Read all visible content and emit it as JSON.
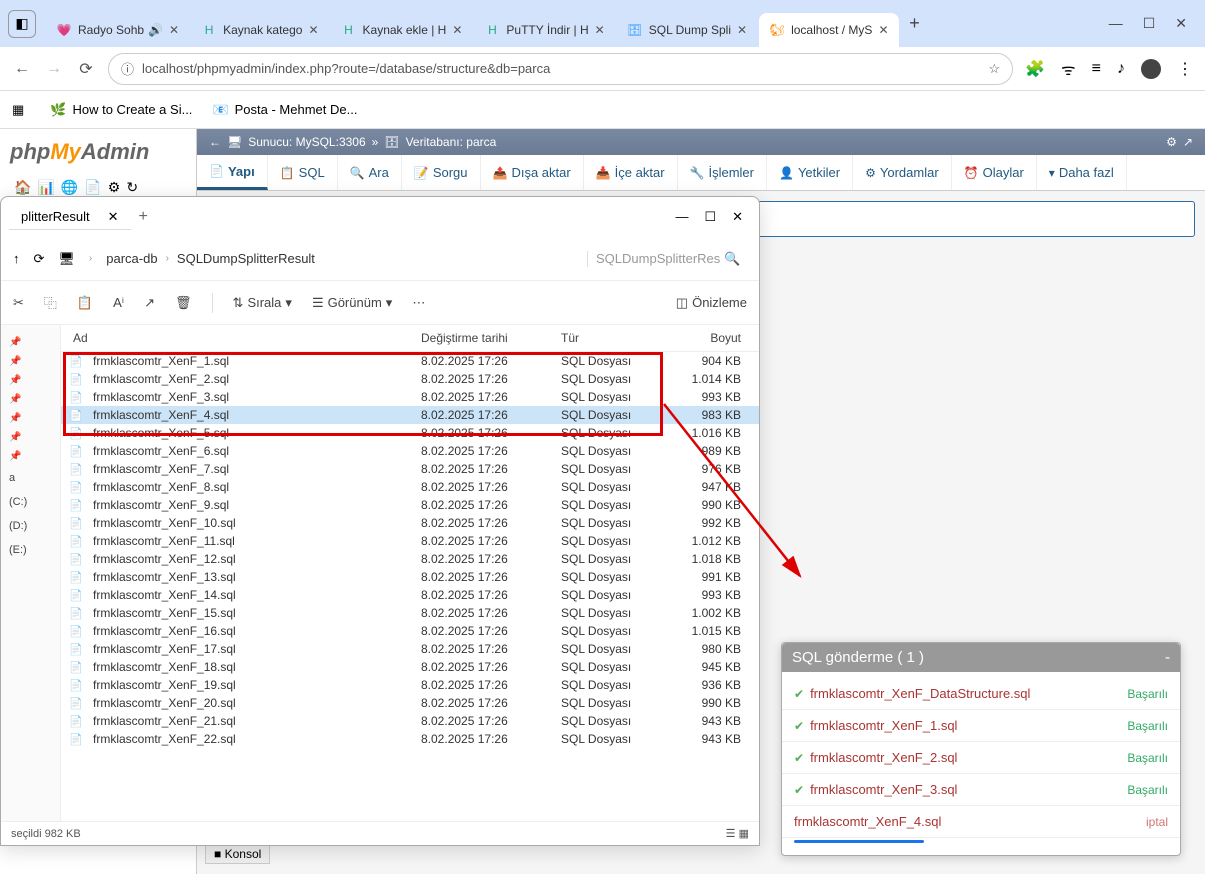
{
  "browser": {
    "tabs": [
      {
        "fav": "💗",
        "title": "Radyo Sohb",
        "extras": "🔊"
      },
      {
        "fav": "H",
        "favcolor": "#2a8",
        "title": "Kaynak katego"
      },
      {
        "fav": "H",
        "favcolor": "#2a8",
        "title": "Kaynak ekle | H"
      },
      {
        "fav": "H",
        "favcolor": "#2a8",
        "title": "PuTTY İndir | H"
      },
      {
        "fav": "🗄",
        "favcolor": "#29f",
        "title": "SQL Dump Spli"
      },
      {
        "fav": "🐿",
        "favcolor": "#f80",
        "title": "localhost / MyS",
        "active": true
      }
    ],
    "url": "localhost/phpmyadmin/index.php?route=/database/structure&db=parca",
    "bookmarks": [
      {
        "icon": "▦",
        "text": ""
      },
      {
        "icon": "🌿",
        "text": "How to Create a Si..."
      },
      {
        "icon": "📧",
        "text": "Posta - Mehmet De..."
      }
    ]
  },
  "pma": {
    "logo": {
      "p1": "php",
      "p2": "My",
      "p3": "Admin"
    },
    "breadcrumb": {
      "server": "Sunucu: MySQL:3306",
      "db": "Veritabanı: parca"
    },
    "tabs": [
      {
        "icon": "📄",
        "label": "Yapı",
        "active": true
      },
      {
        "icon": "📋",
        "label": "SQL"
      },
      {
        "icon": "🔍",
        "label": "Ara"
      },
      {
        "icon": "📝",
        "label": "Sorgu"
      },
      {
        "icon": "📤",
        "label": "Dışa aktar"
      },
      {
        "icon": "📥",
        "label": "İçe aktar"
      },
      {
        "icon": "🔧",
        "label": "İşlemler"
      },
      {
        "icon": "👤",
        "label": "Yetkiler"
      },
      {
        "icon": "⚙",
        "label": "Yordamlar"
      },
      {
        "icon": "⏰",
        "label": "Olaylar"
      },
      {
        "icon": "▾",
        "label": "Daha fazl"
      }
    ]
  },
  "explorer": {
    "tab_title": "plitterResult",
    "path": [
      "parca-db",
      "SQLDumpSplitterResult"
    ],
    "search_placeholder": "SQLDumpSplitterRes",
    "tools": {
      "sort": "Sırala",
      "view": "Görünüm",
      "preview": "Önizleme"
    },
    "headers": {
      "name": "Ad",
      "date": "Değiştirme tarihi",
      "type": "Tür",
      "size": "Boyut"
    },
    "sidebar_items": [
      "a",
      "(C:)",
      "(D:)",
      "(E:)"
    ],
    "rows": [
      {
        "name": "frmklascomtr_XenF_1.sql",
        "date": "8.02.2025 17:26",
        "type": "SQL Dosyası",
        "size": "904 KB",
        "hl": true
      },
      {
        "name": "frmklascomtr_XenF_2.sql",
        "date": "8.02.2025 17:26",
        "type": "SQL Dosyası",
        "size": "1.014 KB",
        "hl": true
      },
      {
        "name": "frmklascomtr_XenF_3.sql",
        "date": "8.02.2025 17:26",
        "type": "SQL Dosyası",
        "size": "993 KB",
        "hl": true
      },
      {
        "name": "frmklascomtr_XenF_4.sql",
        "date": "8.02.2025 17:26",
        "type": "SQL Dosyası",
        "size": "983 KB",
        "hl": true,
        "sel": true
      },
      {
        "name": "frmklascomtr_XenF_5.sql",
        "date": "8.02.2025 17:26",
        "type": "SQL Dosyası",
        "size": "1.016 KB"
      },
      {
        "name": "frmklascomtr_XenF_6.sql",
        "date": "8.02.2025 17:26",
        "type": "SQL Dosyası",
        "size": "989 KB"
      },
      {
        "name": "frmklascomtr_XenF_7.sql",
        "date": "8.02.2025 17:26",
        "type": "SQL Dosyası",
        "size": "976 KB"
      },
      {
        "name": "frmklascomtr_XenF_8.sql",
        "date": "8.02.2025 17:26",
        "type": "SQL Dosyası",
        "size": "947 KB"
      },
      {
        "name": "frmklascomtr_XenF_9.sql",
        "date": "8.02.2025 17:26",
        "type": "SQL Dosyası",
        "size": "990 KB"
      },
      {
        "name": "frmklascomtr_XenF_10.sql",
        "date": "8.02.2025 17:26",
        "type": "SQL Dosyası",
        "size": "992 KB"
      },
      {
        "name": "frmklascomtr_XenF_11.sql",
        "date": "8.02.2025 17:26",
        "type": "SQL Dosyası",
        "size": "1.012 KB"
      },
      {
        "name": "frmklascomtr_XenF_12.sql",
        "date": "8.02.2025 17:26",
        "type": "SQL Dosyası",
        "size": "1.018 KB"
      },
      {
        "name": "frmklascomtr_XenF_13.sql",
        "date": "8.02.2025 17:26",
        "type": "SQL Dosyası",
        "size": "991 KB"
      },
      {
        "name": "frmklascomtr_XenF_14.sql",
        "date": "8.02.2025 17:26",
        "type": "SQL Dosyası",
        "size": "993 KB"
      },
      {
        "name": "frmklascomtr_XenF_15.sql",
        "date": "8.02.2025 17:26",
        "type": "SQL Dosyası",
        "size": "1.002 KB"
      },
      {
        "name": "frmklascomtr_XenF_16.sql",
        "date": "8.02.2025 17:26",
        "type": "SQL Dosyası",
        "size": "1.015 KB"
      },
      {
        "name": "frmklascomtr_XenF_17.sql",
        "date": "8.02.2025 17:26",
        "type": "SQL Dosyası",
        "size": "980 KB"
      },
      {
        "name": "frmklascomtr_XenF_18.sql",
        "date": "8.02.2025 17:26",
        "type": "SQL Dosyası",
        "size": "945 KB"
      },
      {
        "name": "frmklascomtr_XenF_19.sql",
        "date": "8.02.2025 17:26",
        "type": "SQL Dosyası",
        "size": "936 KB"
      },
      {
        "name": "frmklascomtr_XenF_20.sql",
        "date": "8.02.2025 17:26",
        "type": "SQL Dosyası",
        "size": "990 KB"
      },
      {
        "name": "frmklascomtr_XenF_21.sql",
        "date": "8.02.2025 17:26",
        "type": "SQL Dosyası",
        "size": "943 KB"
      },
      {
        "name": "frmklascomtr_XenF_22.sql",
        "date": "8.02.2025 17:26",
        "type": "SQL Dosyası",
        "size": "943 KB"
      }
    ],
    "status": "seçildi  982 KB",
    "konsol": "Konsol"
  },
  "sqlpanel": {
    "title": "SQL gönderme ( 1 )",
    "items": [
      {
        "name": "frmklascomtr_XenF_DataStructure.sql",
        "status": "Başarılı",
        "ok": true
      },
      {
        "name": "frmklascomtr_XenF_1.sql",
        "status": "Başarılı",
        "ok": true
      },
      {
        "name": "frmklascomtr_XenF_2.sql",
        "status": "Başarılı",
        "ok": true
      },
      {
        "name": "frmklascomtr_XenF_3.sql",
        "status": "Başarılı",
        "ok": true
      },
      {
        "name": "frmklascomtr_XenF_4.sql",
        "status": "iptal",
        "loading": true
      }
    ]
  }
}
